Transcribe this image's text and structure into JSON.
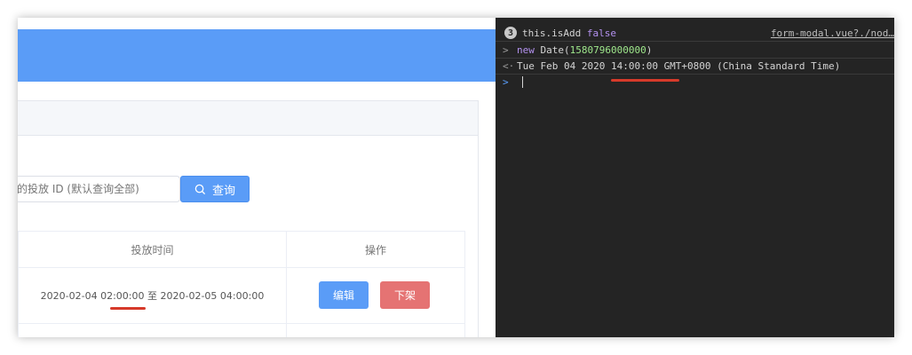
{
  "search": {
    "placeholder": "的投放 ID (默认查询全部)",
    "button_label": "查询"
  },
  "table": {
    "headers": [
      "投放时间",
      "操作"
    ],
    "rows": [
      {
        "time_range": "2020-02-04 02:00:00 至 2020-02-05 04:00:00",
        "edit_label": "编辑",
        "offline_label": "下架"
      }
    ]
  },
  "console": {
    "log_count": "3",
    "log_text": "this.isAdd",
    "log_value": "false",
    "log_source": "form-modal.vue?./nod…",
    "input_keyword": "new",
    "input_call": " Date(",
    "input_arg": "1580796000000",
    "input_close": ")",
    "output_text": "Tue Feb 04 2020 14:00:00 GMT+0800 (China Standard Time)",
    "prompt_input": ">",
    "prompt_output": "<·",
    "prompt_current": ">"
  },
  "colors": {
    "primary": "#5a9cf7",
    "danger": "#e57373",
    "annotation": "#d63a2a",
    "console_bg": "#242424"
  }
}
